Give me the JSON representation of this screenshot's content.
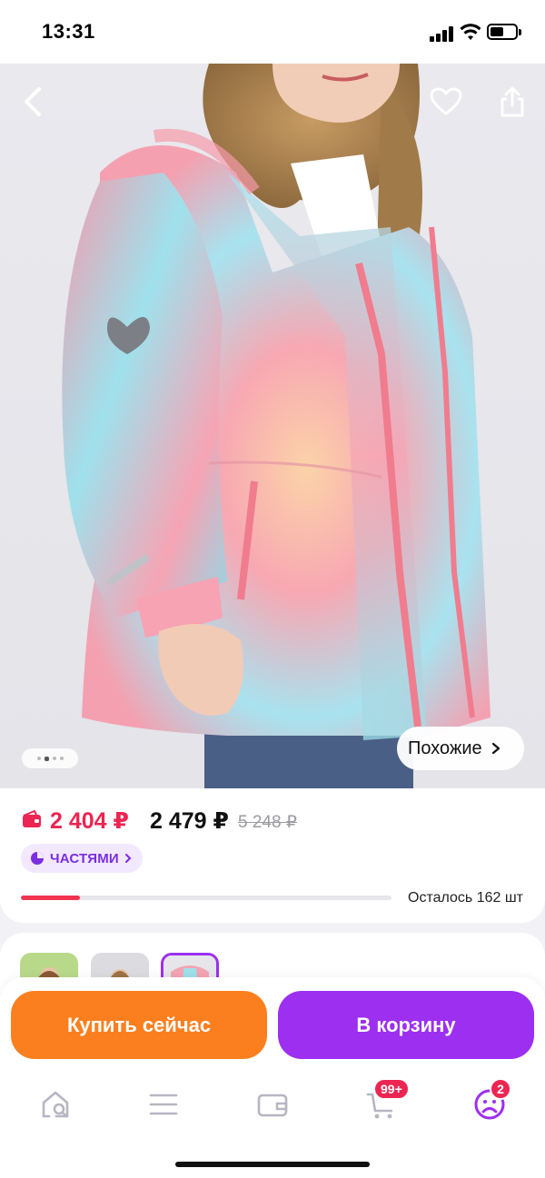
{
  "status_bar": {
    "time": "13:31"
  },
  "gallery": {
    "similar_label": "Похожие",
    "dots_total": 4,
    "dot_active": 1
  },
  "price": {
    "card_price": "2 404 ₽",
    "price": "2 479 ₽",
    "old_price": "5 248 ₽",
    "installments_label": "ЧАСТЯМИ",
    "stock_text": "Осталось 162 шт",
    "stock_fraction": 0.16
  },
  "actions": {
    "buy_now": "Купить сейчас",
    "add_to_cart": "В корзину"
  },
  "tab_bar": {
    "cart_badge": "99+",
    "profile_badge": "2"
  },
  "colors": {
    "card_price": "#ec2552",
    "buy_now": "#fb7f1f",
    "add_to_cart": "#9d2ff0",
    "installments": "#7a2ee0"
  }
}
